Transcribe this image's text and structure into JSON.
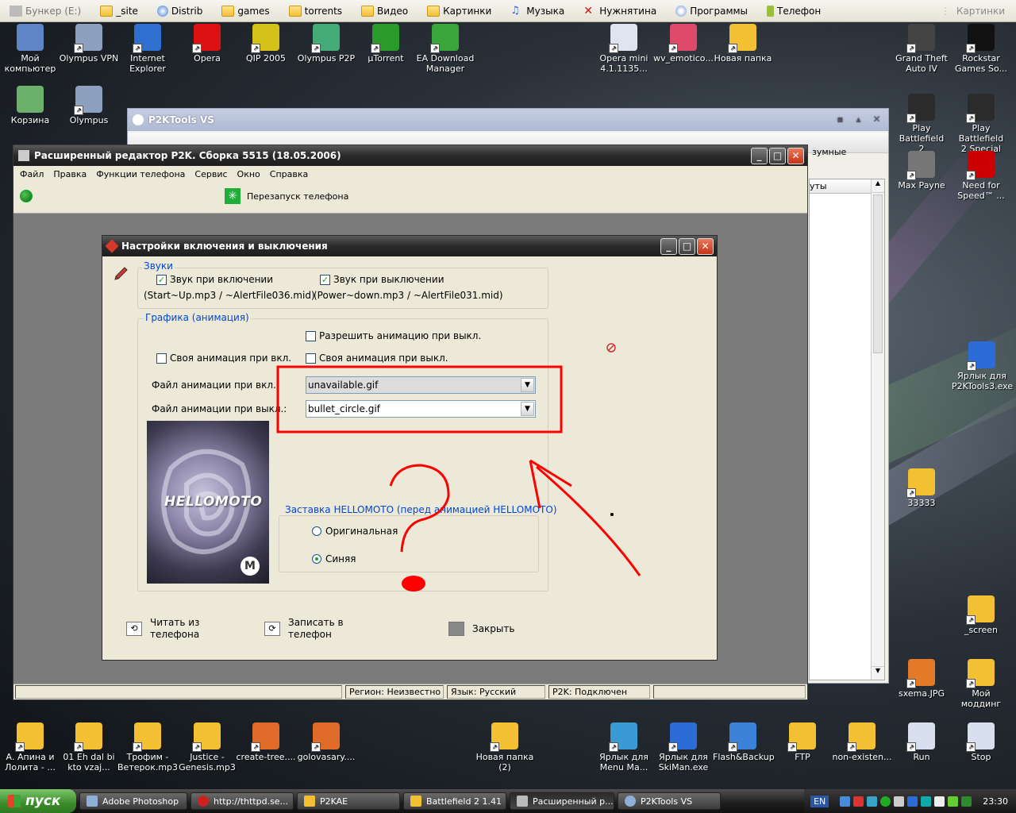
{
  "quickbar": {
    "items": [
      {
        "label": "Бункер (E:)",
        "icon": "drive-icon"
      },
      {
        "label": "_site",
        "icon": "folder-icon"
      },
      {
        "label": "Distrib",
        "icon": "globe-icon"
      },
      {
        "label": "games",
        "icon": "folder-icon"
      },
      {
        "label": "torrents",
        "icon": "folder-icon"
      },
      {
        "label": "Видео",
        "icon": "folder-icon"
      },
      {
        "label": "Картинки",
        "icon": "folder-icon"
      },
      {
        "label": "Музыка",
        "icon": "music-icon"
      },
      {
        "label": "Нужнятина",
        "icon": "x-icon"
      },
      {
        "label": "Программы",
        "icon": "disc-icon"
      },
      {
        "label": "Телефон",
        "icon": "phone-icon"
      }
    ],
    "right_label": "Картинки"
  },
  "desktop_icons": [
    {
      "label": "Мой\nкомпьютер"
    },
    {
      "label": "Olympus VPN"
    },
    {
      "label": "Internet\nExplorer"
    },
    {
      "label": "Opera"
    },
    {
      "label": "QIP 2005"
    },
    {
      "label": "Olympus P2P"
    },
    {
      "label": "µTorrent"
    },
    {
      "label": "EA Download\nManager"
    },
    {
      "label": "Opera mini\n4.1.1135..."
    },
    {
      "label": "wv_emotico..."
    },
    {
      "label": "Новая папка"
    },
    {
      "label": "Grand Theft\nAuto IV"
    },
    {
      "label": "Rockstar\nGames So..."
    },
    {
      "label": "Корзина"
    },
    {
      "label": "Olympus"
    },
    {
      "label": "Play Battlefield\n2"
    },
    {
      "label": "Play Battlefield\n2 Special Fo..."
    },
    {
      "label": "Max Payne"
    },
    {
      "label": "Need for\nSpeed™ ..."
    },
    {
      "label": "Ярлык для\nP2KTools3.exe"
    },
    {
      "label": "33333"
    },
    {
      "label": "_screen"
    },
    {
      "label": "sxema.JPG"
    },
    {
      "label": "Мой моддинг"
    },
    {
      "label": "А. Апина и\nЛолита - ..."
    },
    {
      "label": "01 Eh dal bi\nkto vzaj..."
    },
    {
      "label": "Трофим -\nВетерок.mp3"
    },
    {
      "label": "Justice -\nGenesis.mp3"
    },
    {
      "label": "create-tree...."
    },
    {
      "label": "golovasary...."
    },
    {
      "label": "Новая папка\n(2)"
    },
    {
      "label": "Ярлык для\nMenu Ma..."
    },
    {
      "label": "Ярлык для\nSkiMan.exe"
    },
    {
      "label": "Flash&Backup"
    },
    {
      "label": "FTP"
    },
    {
      "label": "non-existen..."
    },
    {
      "label": "Run"
    },
    {
      "label": "Stop"
    }
  ],
  "p2ktools_window": {
    "title": "P2KTools VS",
    "tab_fragment": "зумные",
    "side_header": "уты"
  },
  "editor": {
    "title": "Расширенный редактор P2K. Сборка 5515 (18.05.2006)",
    "menu": [
      "Файл",
      "Правка",
      "Функции телефона",
      "Сервис",
      "Окно",
      "Справка"
    ],
    "restart_label": "Перезапуск телефона",
    "status": {
      "region": "Регион: Неизвестно",
      "language": "Язык: Русский",
      "p2k": "P2K: Подключен"
    }
  },
  "dialog": {
    "title": "Настройки включения и выключения",
    "sounds": {
      "group_label": "Звуки",
      "sound_on_label": "Звук при включении",
      "sound_on_checked": true,
      "sound_on_files": "(Start~Up.mp3 / ~AlertFile036.mid)",
      "sound_off_label": "Звук при выключении",
      "sound_off_checked": true,
      "sound_off_files": "(Power~down.mp3 / ~AlertFile031.mid)"
    },
    "graphics": {
      "group_label": "Графика (анимация)",
      "allow_anim_off_label": "Разрешить анимацию при выкл.",
      "allow_anim_off_checked": false,
      "own_anim_on_label": "Своя анимация при вкл.",
      "own_anim_on_checked": false,
      "own_anim_off_label": "Своя анимация при выкл.",
      "own_anim_off_checked": false,
      "file_on_label": "Файл анимации при вкл.:",
      "file_on_value": "unavailable.gif",
      "file_off_label": "Файл анимации при выкл.:",
      "file_off_value": "bullet_circle.gif",
      "preview_text": "HELLOMOTO"
    },
    "splash": {
      "group_label": "Заставка HELLOMOTO (перед анимацией HELLOMOTO)",
      "original_label": "Оригинальная",
      "blue_label": "Синяя",
      "selected": "blue"
    },
    "buttons": {
      "read_label": "Читать из\nтелефона",
      "write_label": "Записать в\nтелефон",
      "close_label": "Закрыть"
    }
  },
  "taskbar": {
    "start_label": "пуск",
    "tasks": [
      {
        "label": "Adobe Photoshop",
        "active": false
      },
      {
        "label": "http://thttpd.se...",
        "active": false
      },
      {
        "label": "P2KAE",
        "active": false
      },
      {
        "label": "Battlefield 2 1.41",
        "active": false
      },
      {
        "label": "Расширенный р...",
        "active": true
      },
      {
        "label": "P2KTools VS",
        "active": false
      }
    ],
    "language": "EN",
    "clock": "23:30"
  },
  "colors": {
    "annotation_red": "#ff0000",
    "group_label_blue": "#0046d5"
  }
}
